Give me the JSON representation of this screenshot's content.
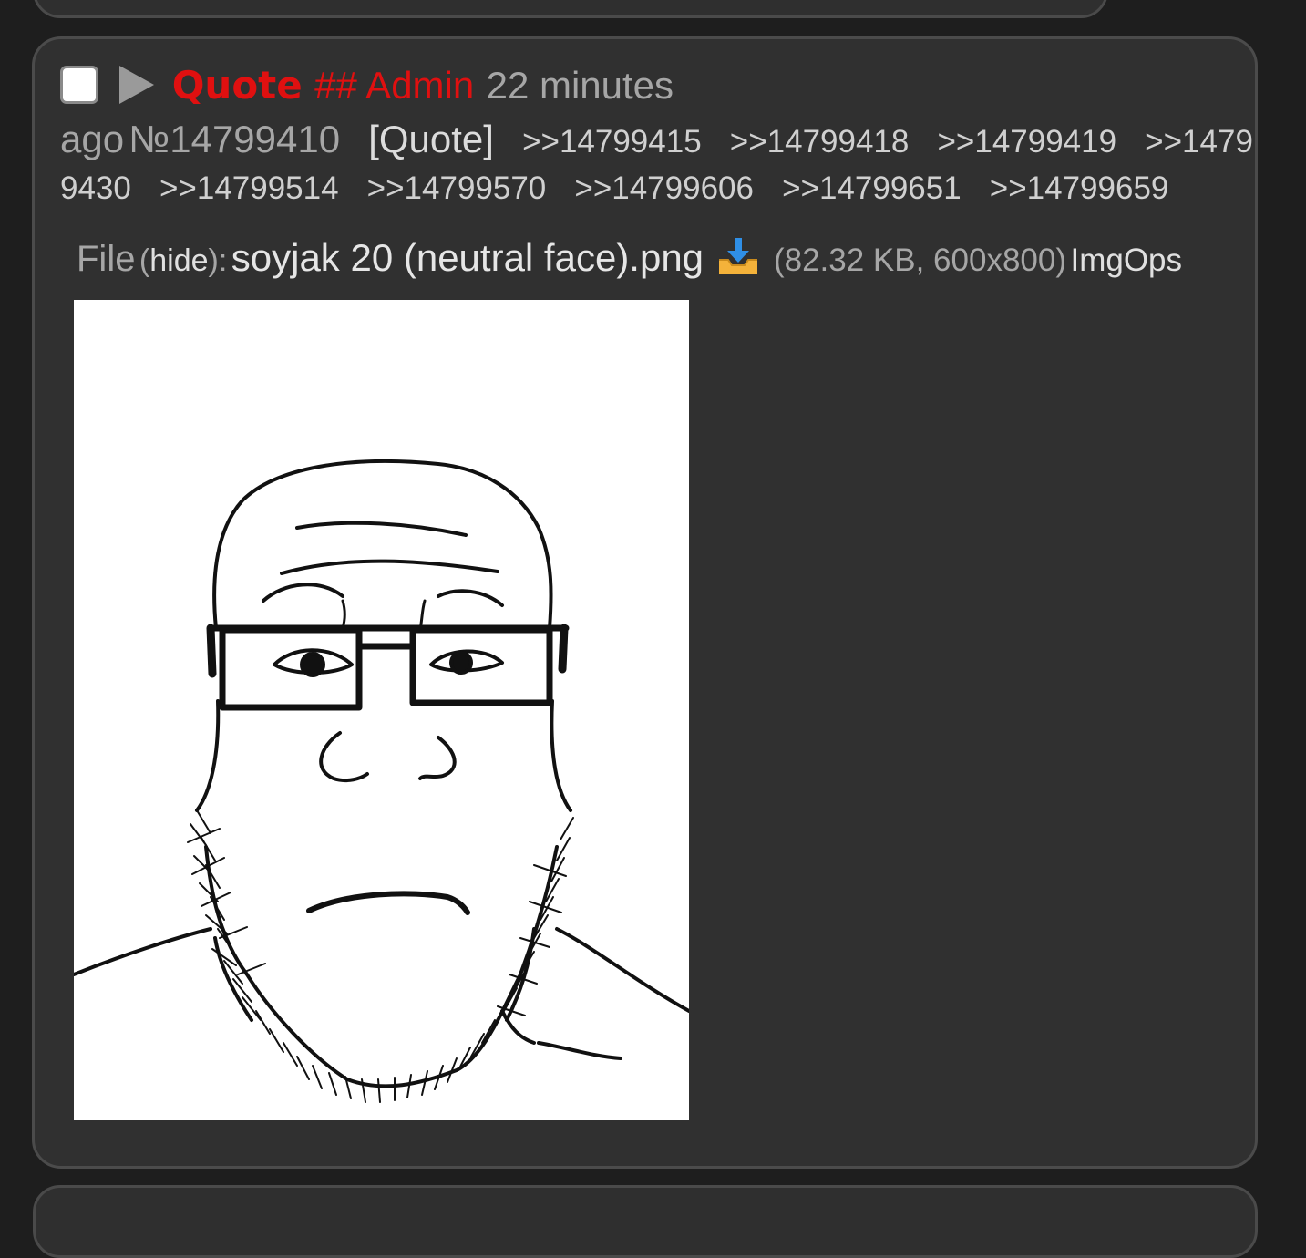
{
  "post": {
    "subject": "Quote",
    "capcode": "## Admin",
    "time_part1": "22 minutes",
    "time_part2": "ago",
    "number": "№14799410",
    "quote_button": "[Quote]",
    "replies": [
      ">>14799415",
      ">>14799418",
      ">>14799419",
      ">>1479",
      "9430",
      ">>14799514",
      ">>14799570",
      ">>14799606",
      ">>14799651",
      ">>14799659"
    ],
    "file": {
      "label": "File",
      "hide_open": "(",
      "hide": "hide",
      "hide_close": "):",
      "name": "soyjak 20 (neutral face).png",
      "meta": "(82.32 KB, 600x800)",
      "imgops": "ImgOps",
      "download_icon": "download-tray-icon"
    }
  },
  "colors": {
    "background": "#1e1e1e",
    "post_background": "#303030",
    "post_border": "#4b4b4b",
    "accent_red": "#e01010",
    "muted_text": "#a6a6a6"
  }
}
